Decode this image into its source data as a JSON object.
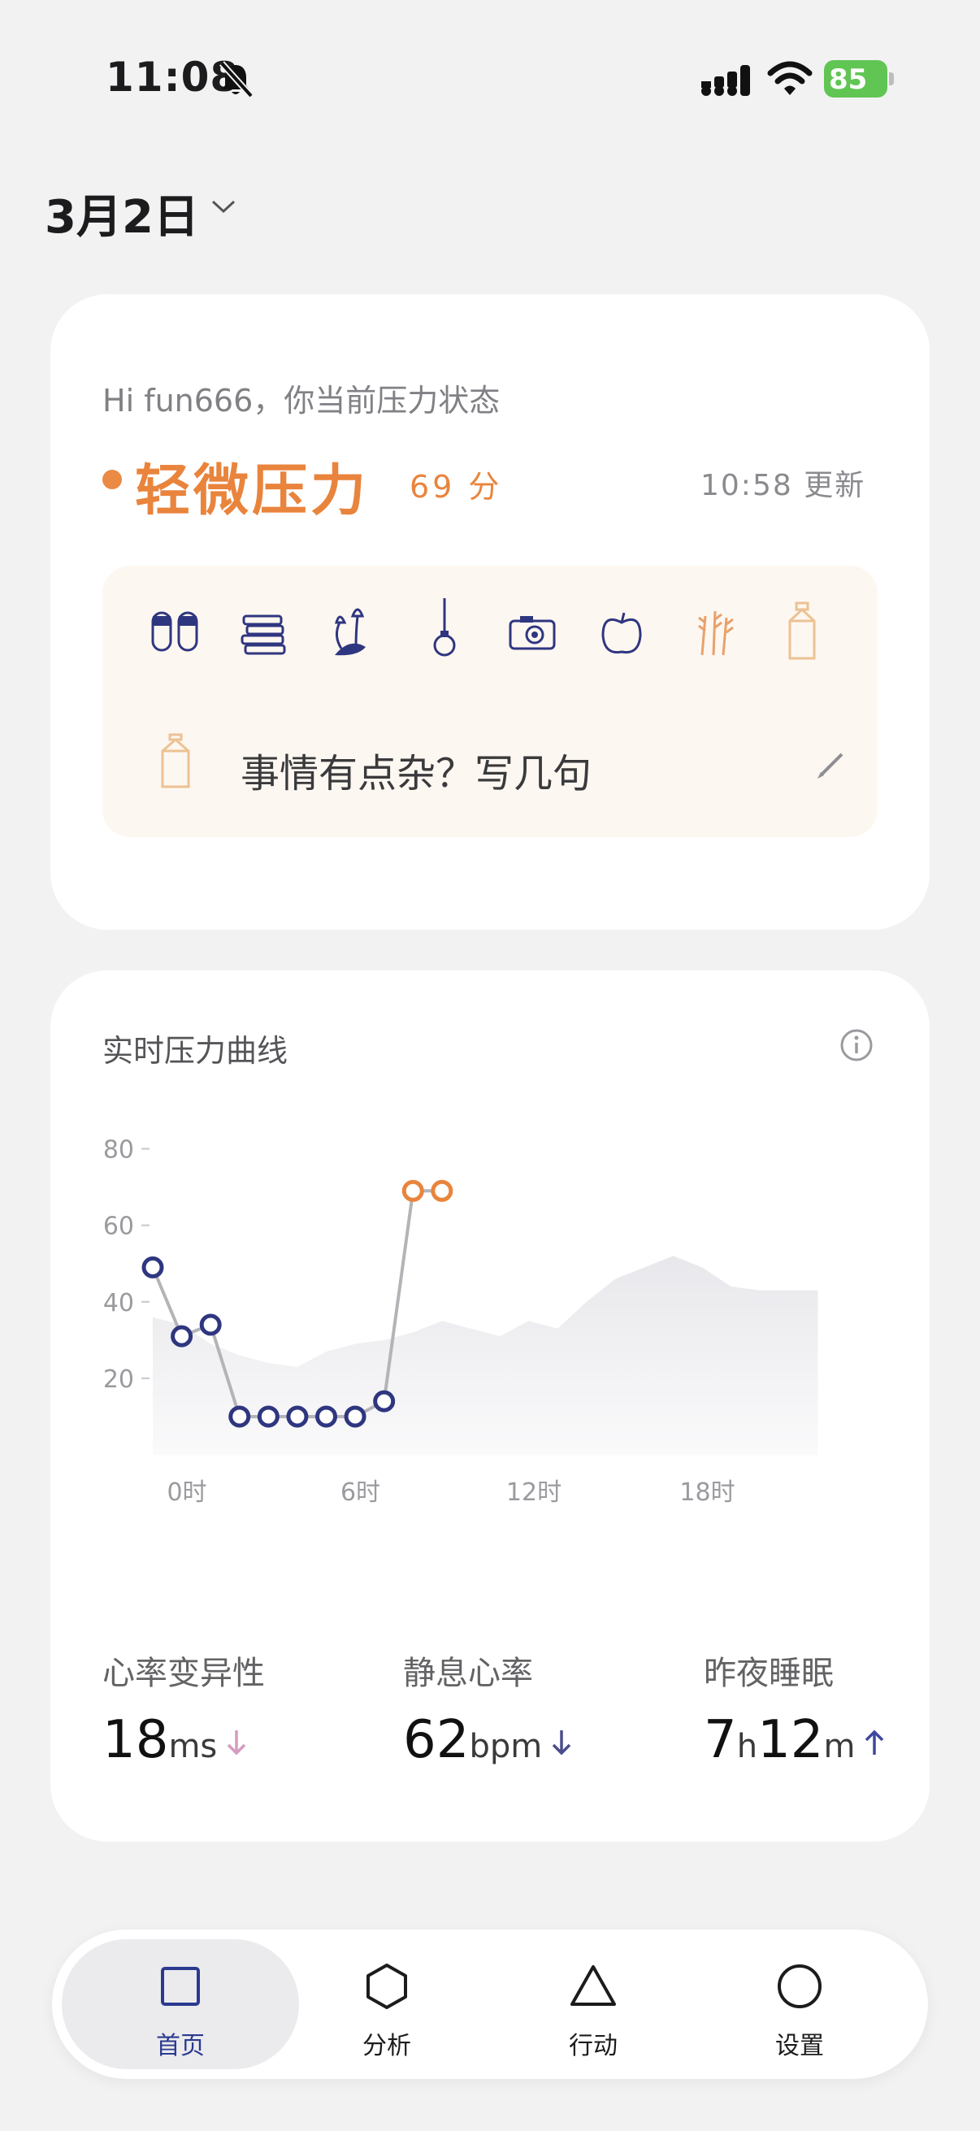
{
  "status_bar": {
    "time": "11:08",
    "battery": "85"
  },
  "date": {
    "label": "3月2日"
  },
  "stress_card": {
    "greeting": "Hi fun666，你当前压力状态",
    "level": "轻微压力",
    "score": "69 分",
    "updated": "10:58 更新",
    "accent_color": "#e9843d",
    "mood_icons": [
      "slippers-icon",
      "books-icon",
      "tulips-icon",
      "lightbulb-icon",
      "camera-icon",
      "apple-icon",
      "wheat-icon",
      "milk-carton-icon"
    ],
    "write_prompt": "事情有点杂？写几句"
  },
  "chart_card": {
    "title": "实时压力曲线",
    "metrics": [
      {
        "label": "心率变异性",
        "value": "18",
        "unit": "ms",
        "trend": "down",
        "color": "#d59bc0"
      },
      {
        "label": "静息心率",
        "value": "62",
        "unit": "bpm",
        "trend": "down",
        "color": "#4b4e8c"
      },
      {
        "label": "昨夜睡眠",
        "value_h": "7",
        "unit_h": "h",
        "value_m": "12",
        "unit_m": "m",
        "trend": "up",
        "color": "#3f48a0"
      }
    ]
  },
  "chart_data": {
    "type": "line",
    "title": "实时压力曲线",
    "xlabel": "",
    "ylabel": "",
    "x_ticks": [
      "0时",
      "6时",
      "12时",
      "18时"
    ],
    "y_ticks": [
      20,
      40,
      60,
      80
    ],
    "xlim": [
      0,
      24
    ],
    "ylim": [
      0,
      85
    ],
    "grid": false,
    "series": [
      {
        "color": "#2f3680",
        "x": [
          0,
          1,
          2,
          3,
          4,
          5,
          6,
          7,
          8
        ],
        "y": [
          49,
          31,
          34,
          10,
          10,
          10,
          10,
          10,
          14
        ]
      },
      {
        "color": "#e9843d",
        "x": [
          9,
          10
        ],
        "y": [
          69,
          69
        ]
      }
    ],
    "background_area": {
      "x": [
        0,
        1,
        2,
        3,
        4,
        5,
        6,
        7,
        8,
        9,
        10,
        11,
        12,
        13,
        14,
        15,
        16,
        17,
        18,
        19,
        20,
        21,
        22,
        23
      ],
      "y": [
        36,
        34,
        29,
        26,
        24,
        23,
        27,
        29,
        30,
        32,
        35,
        33,
        31,
        35,
        33,
        40,
        46,
        49,
        52,
        49,
        44,
        43,
        43,
        43
      ]
    }
  },
  "tabbar": {
    "tabs": [
      {
        "label": "首页",
        "active": true
      },
      {
        "label": "分析",
        "active": false
      },
      {
        "label": "行动",
        "active": false
      },
      {
        "label": "设置",
        "active": false
      }
    ],
    "active_color": "#2b3a8f"
  }
}
